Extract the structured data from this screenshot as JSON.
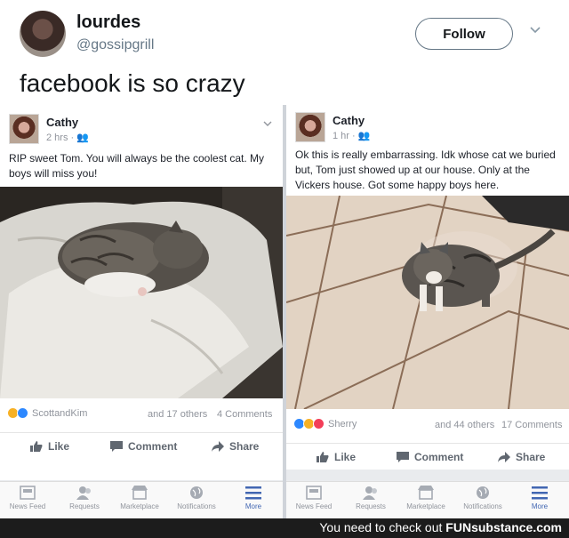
{
  "tweet": {
    "display_name": "lourdes",
    "handle": "@gossipgrill",
    "follow_label": "Follow",
    "text": "facebook is so crazy"
  },
  "posts": [
    {
      "author": "Cathy",
      "time": "2 hrs ·",
      "text": "RIP sweet Tom.  You will always be the coolest cat.  My boys will miss you!",
      "photo_icon": "cat-on-blanket-photo",
      "reaction_name": "ScottandKim",
      "others": "and 17 others",
      "comments": "4 Comments"
    },
    {
      "author": "Cathy",
      "time": "1 hr ·",
      "text": "Ok this is really embarrassing.  Idk whose cat we buried but, Tom just showed up at our house.  Only at the Vickers house.  Got some happy boys here.",
      "photo_icon": "cat-on-tile-floor-photo",
      "reaction_name": "Sherry",
      "others": "and 44 others",
      "comments": "17 Comments"
    }
  ],
  "actions": {
    "like": "Like",
    "comment": "Comment",
    "share": "Share"
  },
  "tabbar": [
    "News Feed",
    "Requests",
    "Marketplace",
    "Notifications",
    "More"
  ],
  "watermark": {
    "prefix": "You need to check out",
    "brand": "FUNsubstance.com"
  },
  "colors": {
    "fb_blue": "#4267b2",
    "muted": "#90949c",
    "like_blue": "#2d88ff",
    "love_red": "#f33e58",
    "haha_yellow": "#f7b125"
  }
}
